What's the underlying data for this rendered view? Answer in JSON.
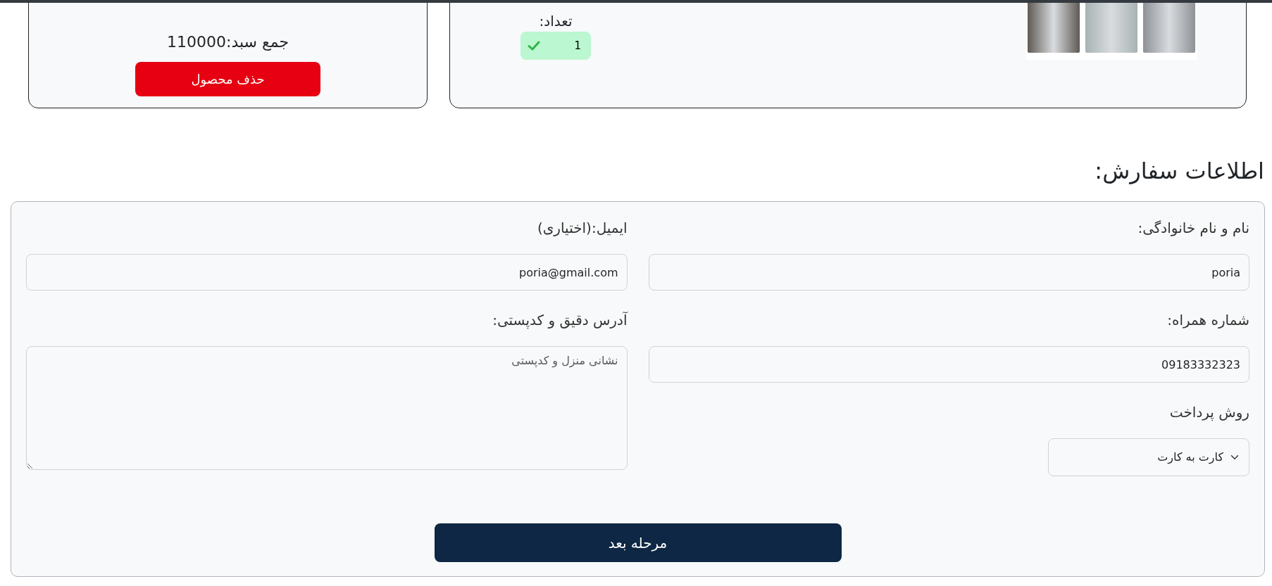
{
  "cart_summary": {
    "total": "جمع سبد:110000",
    "delete_button": "حذف محصول"
  },
  "product": {
    "quantity_label": "تعداد:",
    "quantity": "1",
    "quantity_valid": true
  },
  "order_heading": "اطلاعات سفارش:",
  "form": {
    "fields": [
      {
        "kind": "text",
        "label": "نام و نام خانوادگی:",
        "value": "poria"
      },
      {
        "kind": "text",
        "label": "ایمیل:(اختیاری)",
        "value": "poria@gmail.com"
      },
      {
        "kind": "text",
        "label": "شماره همراه:",
        "value": "09183332323"
      },
      {
        "kind": "textarea",
        "label": "آدرس دقیق و کدپستی:",
        "placeholder": "نشانی منزل و کدپستی"
      },
      {
        "kind": "select",
        "label": "روش پرداخت",
        "value": "کارت به کارت"
      }
    ],
    "submit": "مرحله بعد"
  }
}
